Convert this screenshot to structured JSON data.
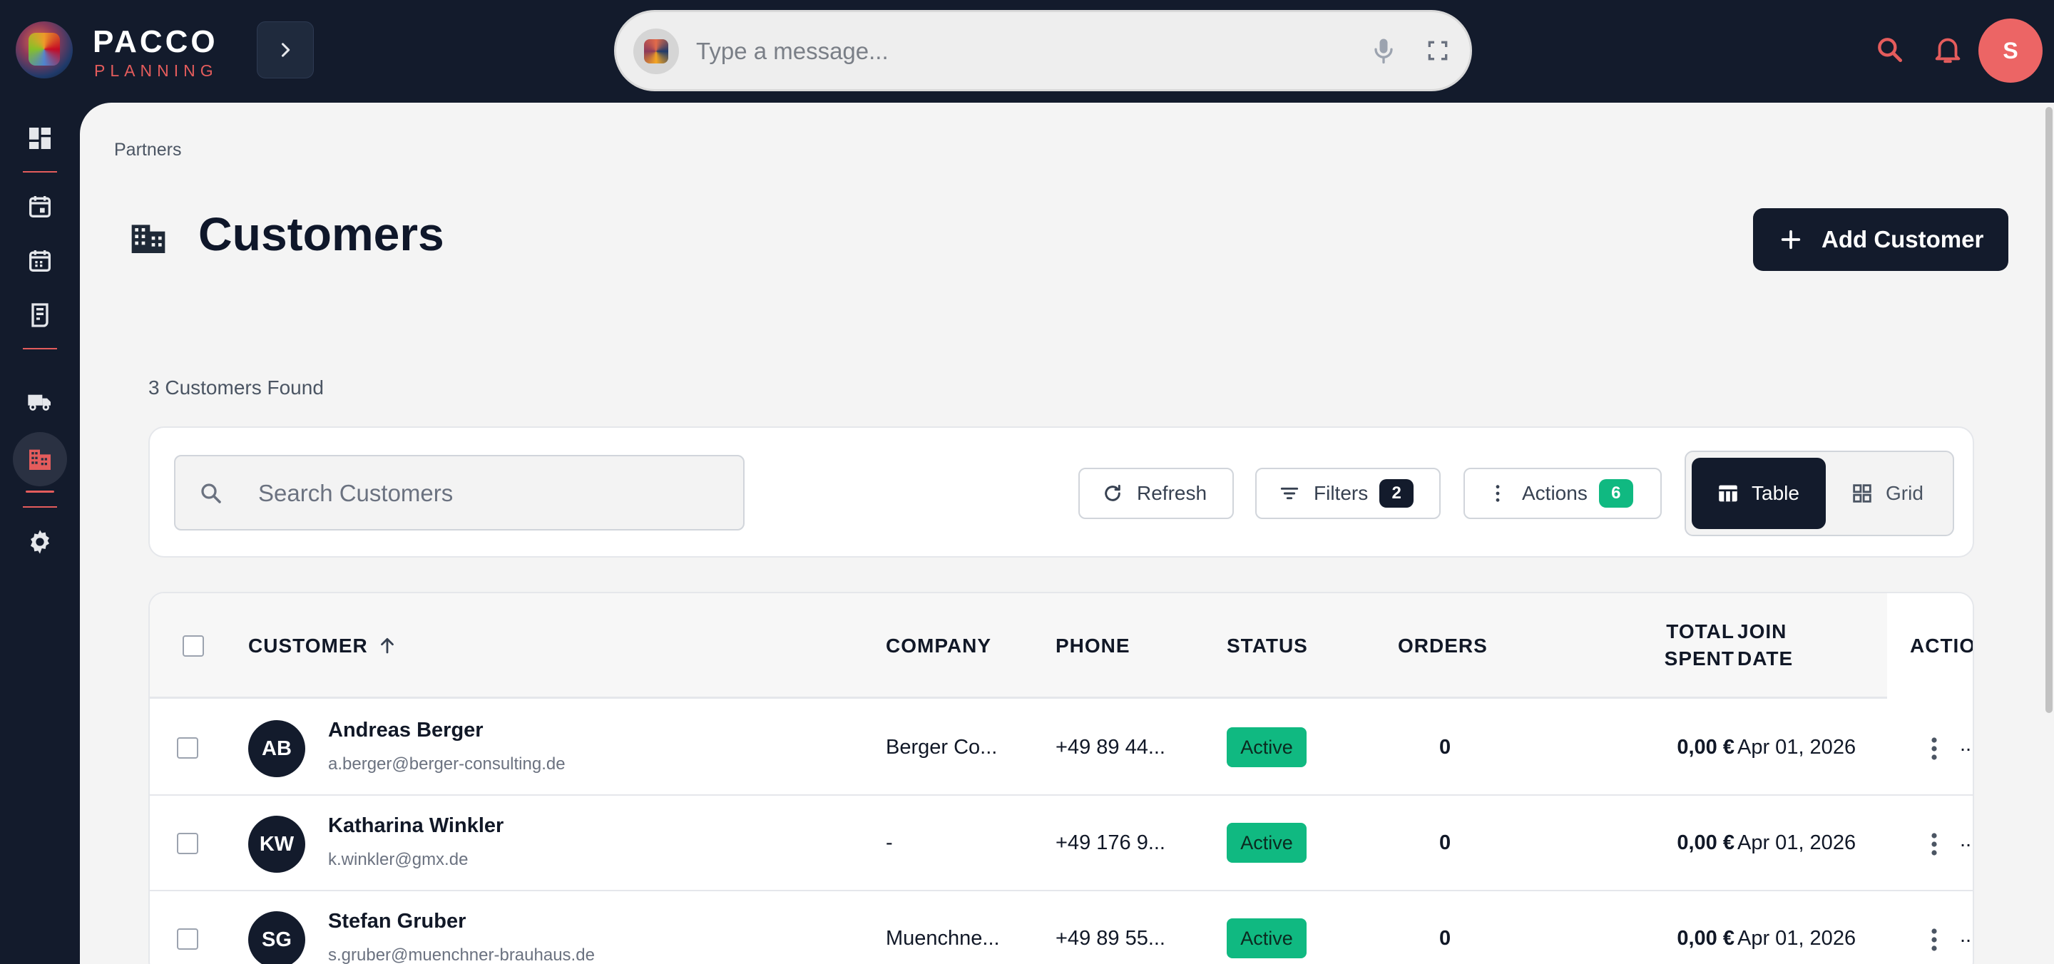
{
  "app": {
    "brand_title": "PACCO",
    "brand_subtitle": "PLANNING",
    "accent_color": "#e45c5c",
    "dark_color": "#131b2c",
    "status_color": "#10b981"
  },
  "topbar": {
    "message_placeholder": "Type a message...",
    "user_initial": "S"
  },
  "sidebar": {
    "items": [
      {
        "icon": "dashboard-icon"
      },
      {
        "icon": "calendar-day-icon"
      },
      {
        "icon": "calendar-icon"
      },
      {
        "icon": "receipt-icon"
      },
      {
        "icon": "truck-icon"
      },
      {
        "icon": "building-icon",
        "active": true
      },
      {
        "icon": "gear-icon"
      }
    ]
  },
  "page": {
    "breadcrumb": "Partners",
    "title": "Customers",
    "add_button_label": "Add Customer",
    "count_text": "3 Customers Found"
  },
  "toolbar": {
    "search_placeholder": "Search Customers",
    "refresh_label": "Refresh",
    "filters_label": "Filters",
    "filters_count": "2",
    "actions_label": "Actions",
    "actions_count": "6",
    "view_table_label": "Table",
    "view_grid_label": "Grid"
  },
  "table": {
    "columns": {
      "customer": "CUSTOMER",
      "company": "COMPANY",
      "phone": "PHONE",
      "status": "STATUS",
      "orders": "ORDERS",
      "total_spent_1": "TOTAL",
      "total_spent_2": "SPENT",
      "join_date_1": "JOIN",
      "join_date_2": "DATE",
      "actions": "ACTIO"
    },
    "rows": [
      {
        "initials": "AB",
        "name": "Andreas Berger",
        "email": "a.berger@berger-consulting.de",
        "company": "Berger Co...",
        "phone": "+49 89 44...",
        "status": "Active",
        "orders": "0",
        "total": "0,00 €",
        "join_date": "Apr 01, 2026",
        "more": ".."
      },
      {
        "initials": "KW",
        "name": "Katharina Winkler",
        "email": "k.winkler@gmx.de",
        "company": "-",
        "phone": "+49 176 9...",
        "status": "Active",
        "orders": "0",
        "total": "0,00 €",
        "join_date": "Apr 01, 2026",
        "more": ".."
      },
      {
        "initials": "SG",
        "name": "Stefan Gruber",
        "email": "s.gruber@muenchner-brauhaus.de",
        "company": "Muenchne...",
        "phone": "+49 89 55...",
        "status": "Active",
        "orders": "0",
        "total": "0,00 €",
        "join_date": "Apr 01, 2026",
        "more": ".."
      }
    ]
  }
}
